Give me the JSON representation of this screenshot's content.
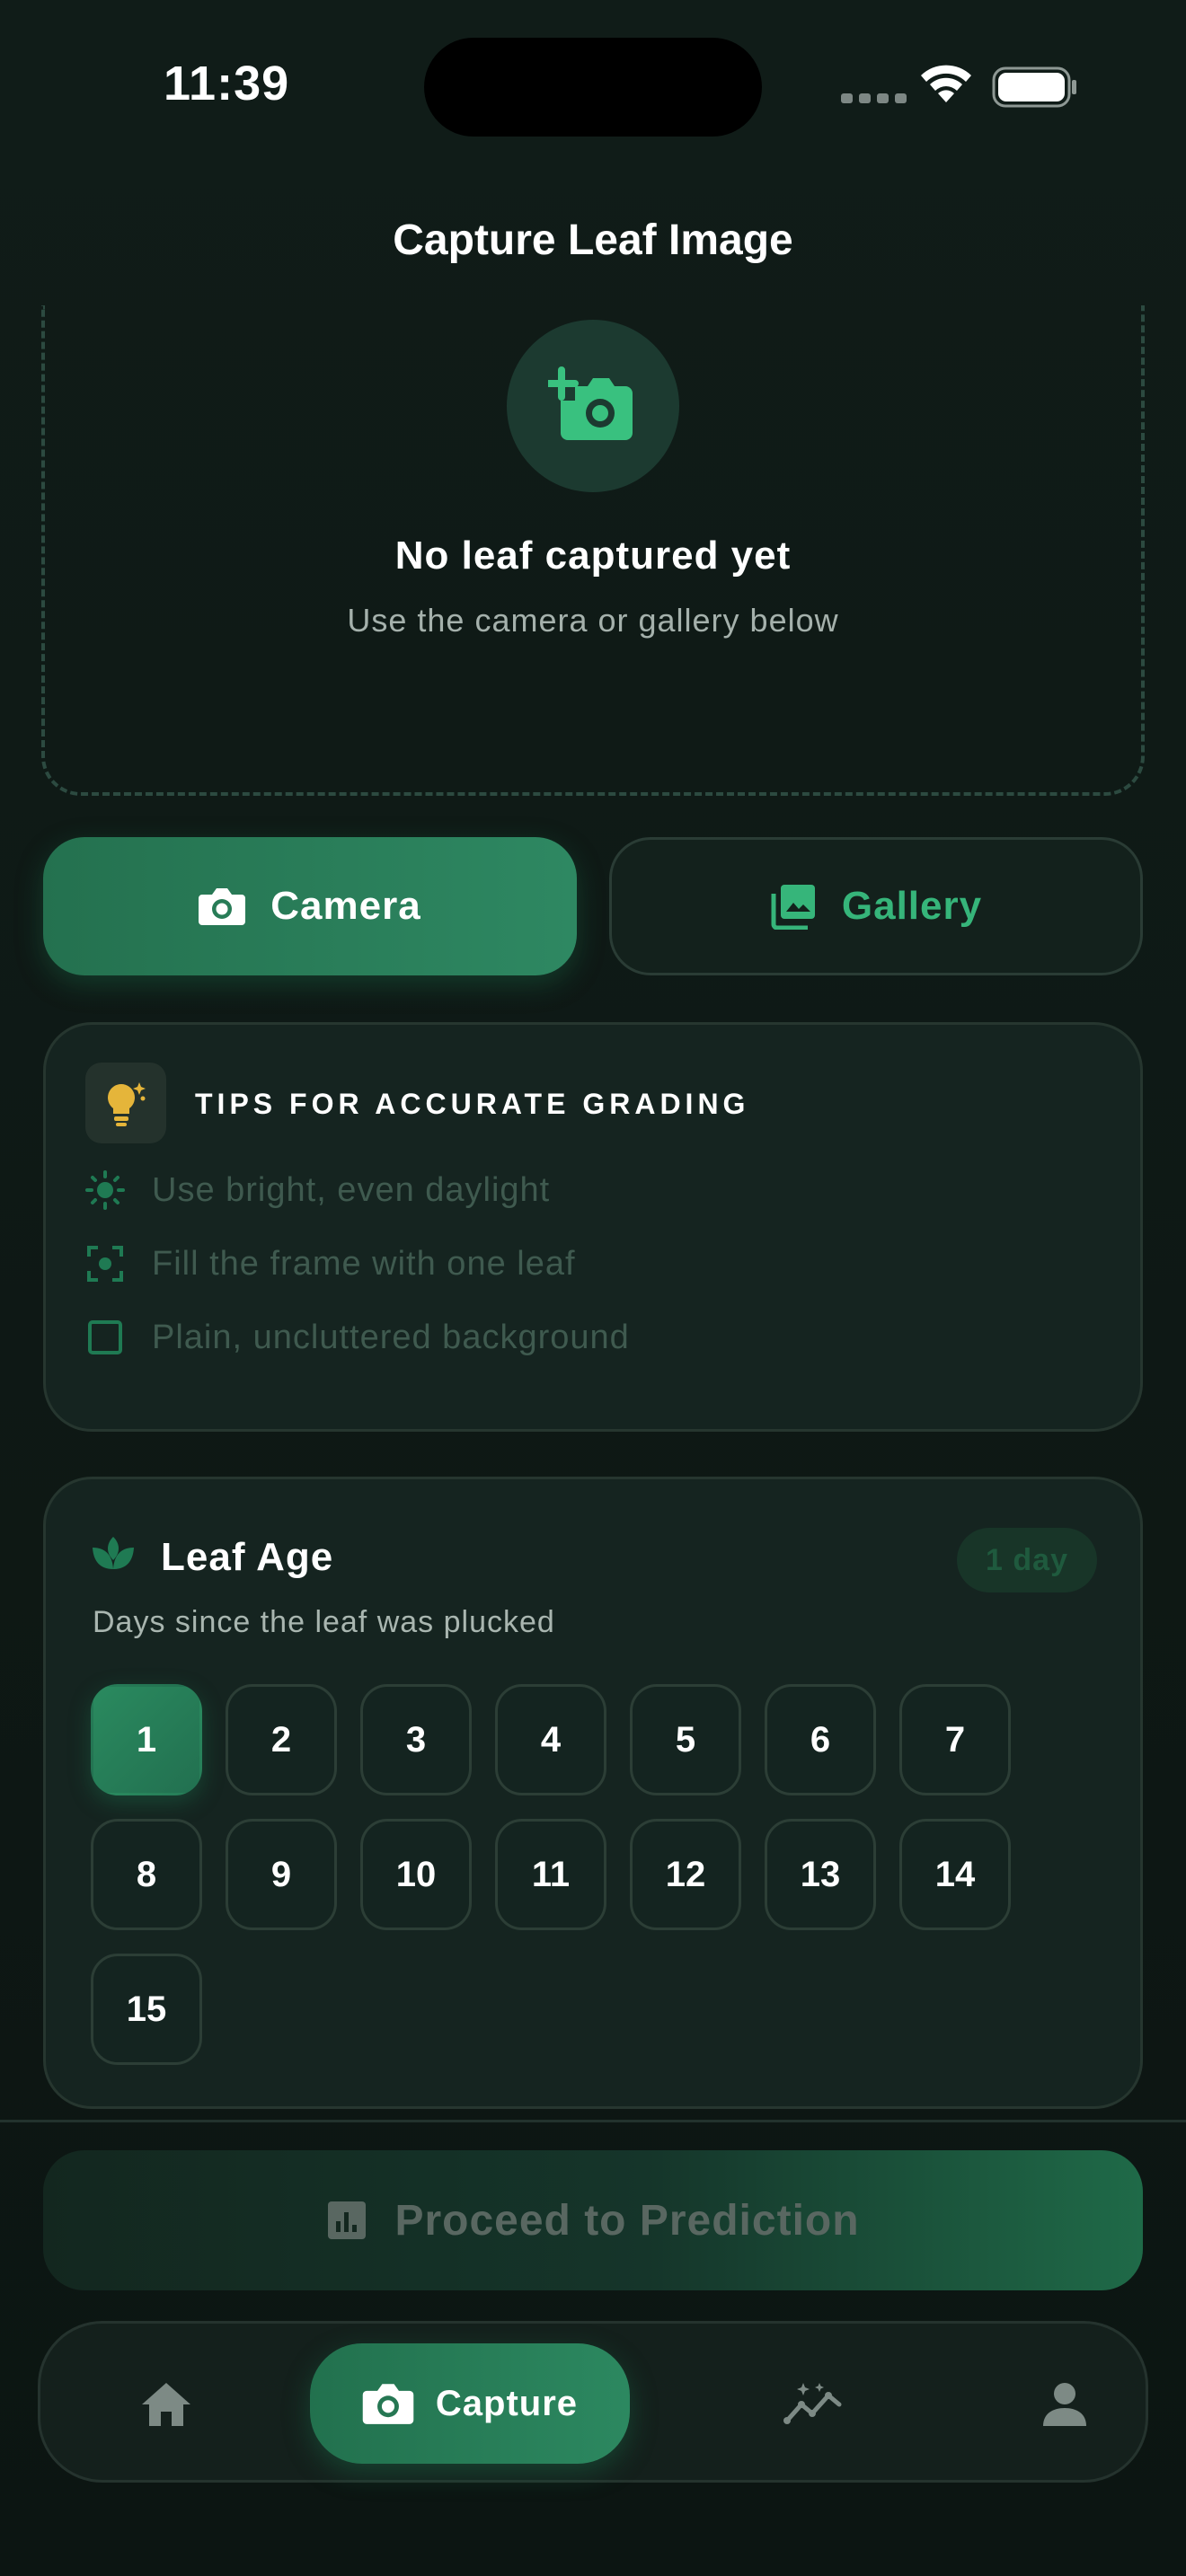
{
  "status_bar": {
    "time": "11:39"
  },
  "header": {
    "title": "Capture Leaf Image"
  },
  "capture": {
    "empty_title": "No leaf captured yet",
    "empty_subtitle": "Use the camera or gallery below",
    "icon": "add-camera-icon"
  },
  "actions": {
    "camera_label": "Camera",
    "gallery_label": "Gallery"
  },
  "tips": {
    "title": "TIPS FOR ACCURATE GRADING",
    "icon": "lightbulb-icon",
    "items": [
      {
        "icon": "sun-icon",
        "text": "Use bright, even daylight"
      },
      {
        "icon": "focus-frame-icon",
        "text": "Fill the frame with one leaf"
      },
      {
        "icon": "square-icon",
        "text": "Plain, uncluttered background"
      }
    ]
  },
  "leaf_age": {
    "title": "Leaf Age",
    "badge": "1 day",
    "subtitle": "Days since the leaf was plucked",
    "days": [
      "1",
      "2",
      "3",
      "4",
      "5",
      "6",
      "7",
      "8",
      "9",
      "10",
      "11",
      "12",
      "13",
      "14",
      "15"
    ],
    "selected": "1"
  },
  "proceed": {
    "label": "Proceed to Prediction"
  },
  "bottom_nav": {
    "items": [
      {
        "icon": "home-icon",
        "label": ""
      },
      {
        "icon": "camera-icon",
        "label": "Capture"
      },
      {
        "icon": "insights-icon",
        "label": ""
      },
      {
        "icon": "person-icon",
        "label": ""
      }
    ]
  },
  "colors": {
    "accent": "#2c8860",
    "accent_text": "#36b57a",
    "background": "#0d1714",
    "card": "#152420",
    "tip_icon": "#1f7a53",
    "bulb": "#e5b53a"
  }
}
